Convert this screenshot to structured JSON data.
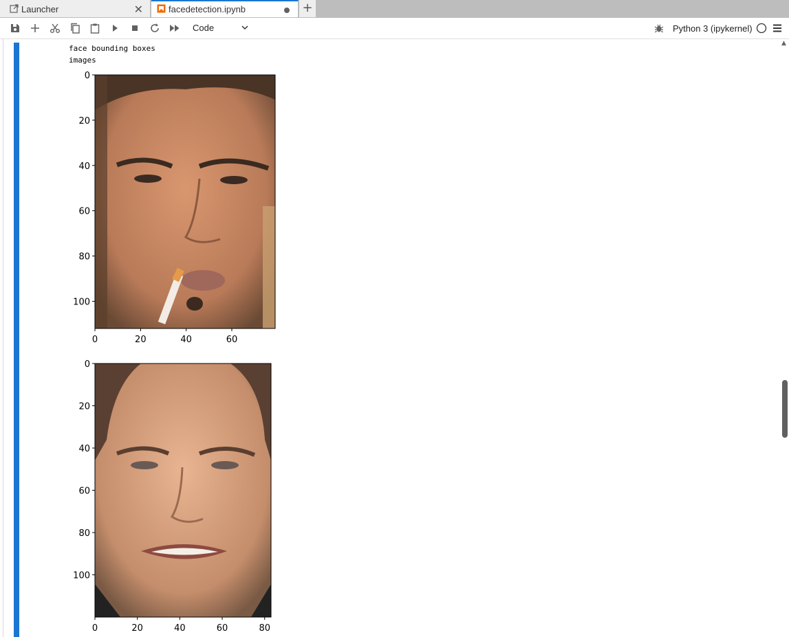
{
  "tabs": [
    {
      "label": "Launcher",
      "icon": "launcher-icon",
      "state": "close-button"
    },
    {
      "label": "facedetection.ipynb",
      "icon": "notebook-icon",
      "state": "unsaved-dot"
    }
  ],
  "toolbar": {
    "buttons": [
      "save-icon",
      "add-cell-icon",
      "cut-icon",
      "copy-icon",
      "paste-icon",
      "run-icon",
      "stop-icon",
      "restart-icon",
      "run-all-icon"
    ],
    "cell_type": "Code",
    "kernel_name": "Python 3 (ipykernel)",
    "kernel_status": "idle"
  },
  "output": {
    "lines": [
      "face bounding boxes",
      "images"
    ]
  },
  "plots": [
    {
      "description_icon": "face-image-1",
      "xticks": [
        "0",
        "20",
        "40",
        "60"
      ],
      "yticks": [
        "0",
        "20",
        "40",
        "60",
        "80",
        "100"
      ],
      "xlim": [
        0,
        79
      ],
      "ylim": [
        112,
        0
      ]
    },
    {
      "description_icon": "face-image-2",
      "xticks": [
        "0",
        "20",
        "40",
        "60",
        "80"
      ],
      "yticks": [
        "0",
        "20",
        "40",
        "60",
        "80",
        "100"
      ],
      "xlim": [
        0,
        83
      ],
      "ylim": [
        120,
        0
      ]
    }
  ],
  "colors": {
    "accent": "#1976d2",
    "tab_bar": "#bdbdbd"
  }
}
